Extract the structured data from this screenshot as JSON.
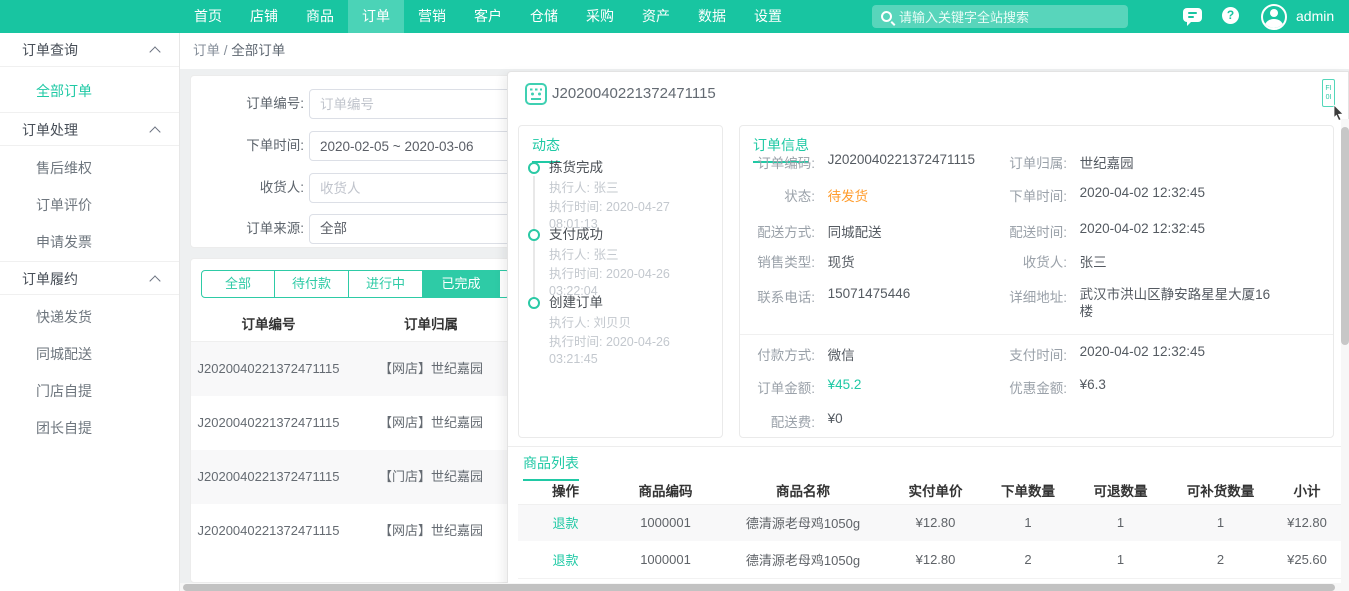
{
  "colors": {
    "accent": "#20c9a5",
    "navbar": "#18c5a1",
    "status_warning": "#ff9d2f",
    "amount_green": "#20c9a5"
  },
  "navbar": {
    "items": [
      "首页",
      "店铺",
      "商品",
      "订单",
      "营销",
      "客户",
      "仓储",
      "采购",
      "资产",
      "数据",
      "设置"
    ],
    "active_item": "订单",
    "search_placeholder": "请输入关键字全站搜索",
    "username": "admin"
  },
  "sidebar": {
    "active_item": "全部订单",
    "sections": [
      {
        "title": "订单查询",
        "items": [
          "全部订单"
        ]
      },
      {
        "title": "订单处理",
        "items": [
          "售后维权",
          "订单评价",
          "申请发票"
        ]
      },
      {
        "title": "订单履约",
        "items": [
          "快递发货",
          "同城配送",
          "门店自提",
          "团长自提"
        ]
      }
    ]
  },
  "breadcrumb": {
    "section": "订单",
    "separator": "/",
    "current": "全部订单"
  },
  "filters": {
    "order_no_label": "订单编号:",
    "order_no_placeholder": "订单编号",
    "order_time_label": "下单时间:",
    "order_time_value": "2020-02-05 ~ 2020-03-06",
    "receiver_label": "收货人:",
    "receiver_placeholder": "收货人",
    "source_label": "订单来源:",
    "source_value": "全部"
  },
  "order_list": {
    "tabs": [
      "全部",
      "待付款",
      "进行中",
      "已完成"
    ],
    "active_tab": "已完成",
    "columns": [
      "订单编号",
      "订单归属"
    ],
    "rows": [
      {
        "order_no": "J2020040221372471115",
        "belong": "【网店】世纪嘉园"
      },
      {
        "order_no": "J2020040221372471115",
        "belong": "【网店】世纪嘉园"
      },
      {
        "order_no": "J2020040221372471115",
        "belong": "【门店】世纪嘉园"
      },
      {
        "order_no": "J2020040221372471115",
        "belong": "【网店】世纪嘉园"
      }
    ]
  },
  "detail": {
    "order_no": "J2020040221372471115",
    "corner_tag_line1": "FI",
    "corner_tag_line2": "0I",
    "timeline": {
      "title": "动态",
      "events": [
        {
          "name": "拣货完成",
          "operator": "执行人: 张三",
          "time": "执行时间: 2020-04-27 08:01:13"
        },
        {
          "name": "支付成功",
          "operator": "执行人: 张三",
          "time": "执行时间: 2020-04-26 03:22:04"
        },
        {
          "name": "创建订单",
          "operator": "执行人: 刘贝贝",
          "time": "执行时间: 2020-04-26 03:21:45"
        }
      ]
    },
    "info": {
      "title": "订单信息",
      "order_code_label": "订单编码:",
      "order_code": "J2020040221372471115",
      "belong_label": "订单归属:",
      "belong": "世纪嘉园",
      "status_label": "状态:",
      "status": "待发货",
      "order_time_label": "下单时间:",
      "order_time": "2020-04-02 12:32:45",
      "delivery_mode_label": "配送方式:",
      "delivery_mode": "同城配送",
      "delivery_time_label": "配送时间:",
      "delivery_time": "2020-04-02 12:32:45",
      "sale_type_label": "销售类型:",
      "sale_type": "现货",
      "receiver_label": "收货人:",
      "receiver": "张三",
      "phone_label": "联系电话:",
      "phone": "15071475446",
      "address_label": "详细地址:",
      "address": "武汉市洪山区静安路星星大厦16楼",
      "pay_method_label": "付款方式:",
      "pay_method": "微信",
      "pay_time_label": "支付时间:",
      "pay_time": "2020-04-02 12:32:45",
      "order_amount_label": "订单金额:",
      "order_amount": "¥45.2",
      "discount_label": "优惠金额:",
      "discount": "¥6.3",
      "delivery_fee_label": "配送费:",
      "delivery_fee": "¥0"
    },
    "products": {
      "title": "商品列表",
      "columns": [
        "操作",
        "商品编码",
        "商品名称",
        "实付单价",
        "下单数量",
        "可退数量",
        "可补货数量",
        "小计"
      ],
      "rows": [
        {
          "action": "退款",
          "code": "1000001",
          "name": "德清源老母鸡1050g",
          "price": "¥12.80",
          "qty": "1",
          "refundable": "1",
          "replenishable": "1",
          "subtotal": "¥12.80"
        },
        {
          "action": "退款",
          "code": "1000001",
          "name": "德清源老母鸡1050g",
          "price": "¥12.80",
          "qty": "2",
          "refundable": "1",
          "replenishable": "2",
          "subtotal": "¥25.60"
        }
      ]
    }
  }
}
